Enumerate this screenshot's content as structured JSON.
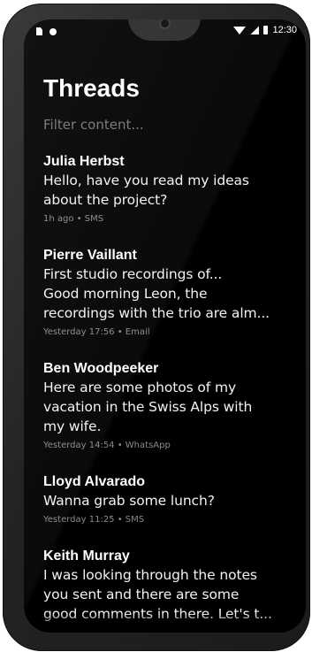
{
  "status_bar": {
    "time": "12:30",
    "left_icons": [
      "sim-card-icon",
      "notification-dot-icon"
    ],
    "right_icons": [
      "wifi-icon",
      "signal-icon",
      "battery-icon"
    ]
  },
  "header": {
    "title": "Threads"
  },
  "filter": {
    "placeholder": "Filter content..."
  },
  "threads": [
    {
      "sender": "Julia Herbst",
      "preview_lines": [
        "Hello, have you read my ideas",
        "about the project?"
      ],
      "meta": "1h ago • SMS"
    },
    {
      "sender": "Pierre Vaillant",
      "preview_lines": [
        "First studio recordings of...",
        "Good morning Leon, the",
        "recordings with the trio are alm..."
      ],
      "meta": "Yesterday 17:56 • Email"
    },
    {
      "sender": "Ben Woodpeeker",
      "preview_lines": [
        "Here are some photos of my",
        "vacation in the Swiss Alps with",
        "my wife."
      ],
      "meta": "Yesterday 14:54 • WhatsApp"
    },
    {
      "sender": "Lloyd Alvarado",
      "preview_lines": [
        "Wanna grab some lunch?"
      ],
      "meta": "Yesterday 11:25 • SMS"
    },
    {
      "sender": "Keith Murray",
      "preview_lines": [
        "I was looking through the notes",
        "you sent and there are some",
        "good comments in there. Let's t..."
      ],
      "meta": ""
    }
  ],
  "colors": {
    "background": "#000000",
    "text_primary": "#ffffff",
    "text_meta": "#8a8a8a",
    "device_frame": "#2a2a2a"
  }
}
